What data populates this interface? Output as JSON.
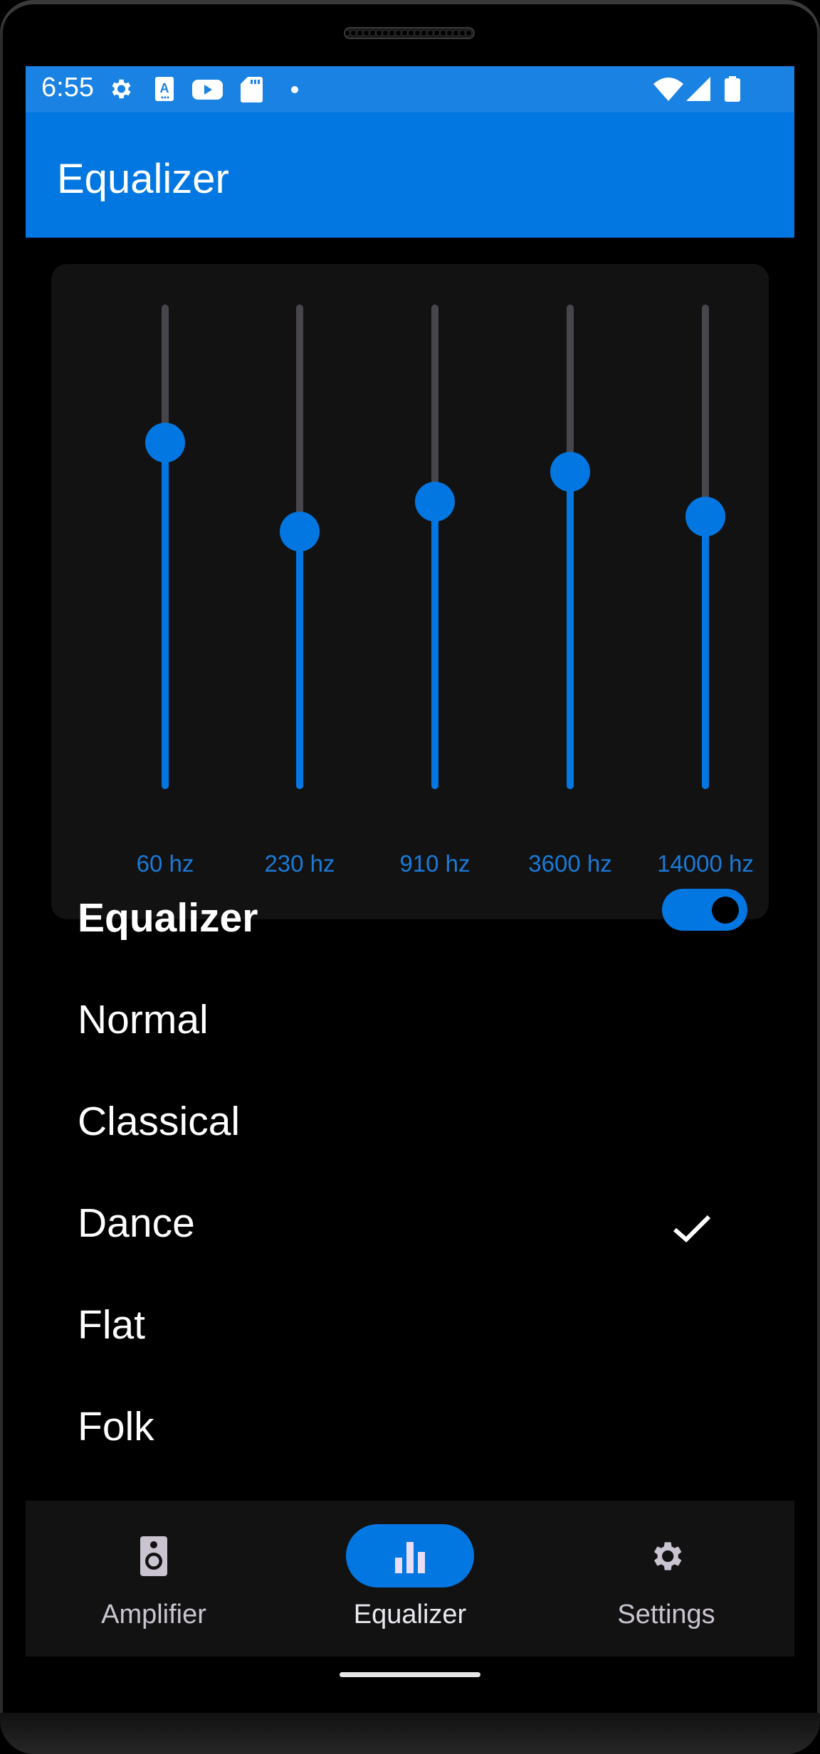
{
  "statusbar": {
    "time": "6:55",
    "icons": [
      "settings-icon",
      "font-a-icon",
      "youtube-icon",
      "sd-card-icon",
      "notification-dot-icon",
      "wifi-icon",
      "cell-signal-icon",
      "battery-icon"
    ]
  },
  "appbar": {
    "title": "Equalizer"
  },
  "equalizer": {
    "bands": [
      {
        "label": "60 hz",
        "level": 0.715
      },
      {
        "label": "230 hz",
        "level": 0.532
      },
      {
        "label": "910 hz",
        "level": 0.593
      },
      {
        "label": "3600 hz",
        "level": 0.655
      },
      {
        "label": "14000 hz",
        "level": 0.562
      }
    ],
    "toggle_label": "Equalizer",
    "enabled": true
  },
  "presets": {
    "items": [
      {
        "label": "Normal",
        "selected": false
      },
      {
        "label": "Classical",
        "selected": false
      },
      {
        "label": "Dance",
        "selected": true
      },
      {
        "label": "Flat",
        "selected": false
      },
      {
        "label": "Folk",
        "selected": false
      }
    ]
  },
  "nav": {
    "items": [
      {
        "label": "Amplifier",
        "icon": "speaker-icon",
        "active": false
      },
      {
        "label": "Equalizer",
        "icon": "equalizer-bars-icon",
        "active": true
      },
      {
        "label": "Settings",
        "icon": "settings-icon",
        "active": false
      }
    ]
  },
  "colors": {
    "accent": "#0277e2",
    "statusbar": "#1a82e2",
    "surface": "#121212",
    "track_inactive": "#48464c"
  }
}
